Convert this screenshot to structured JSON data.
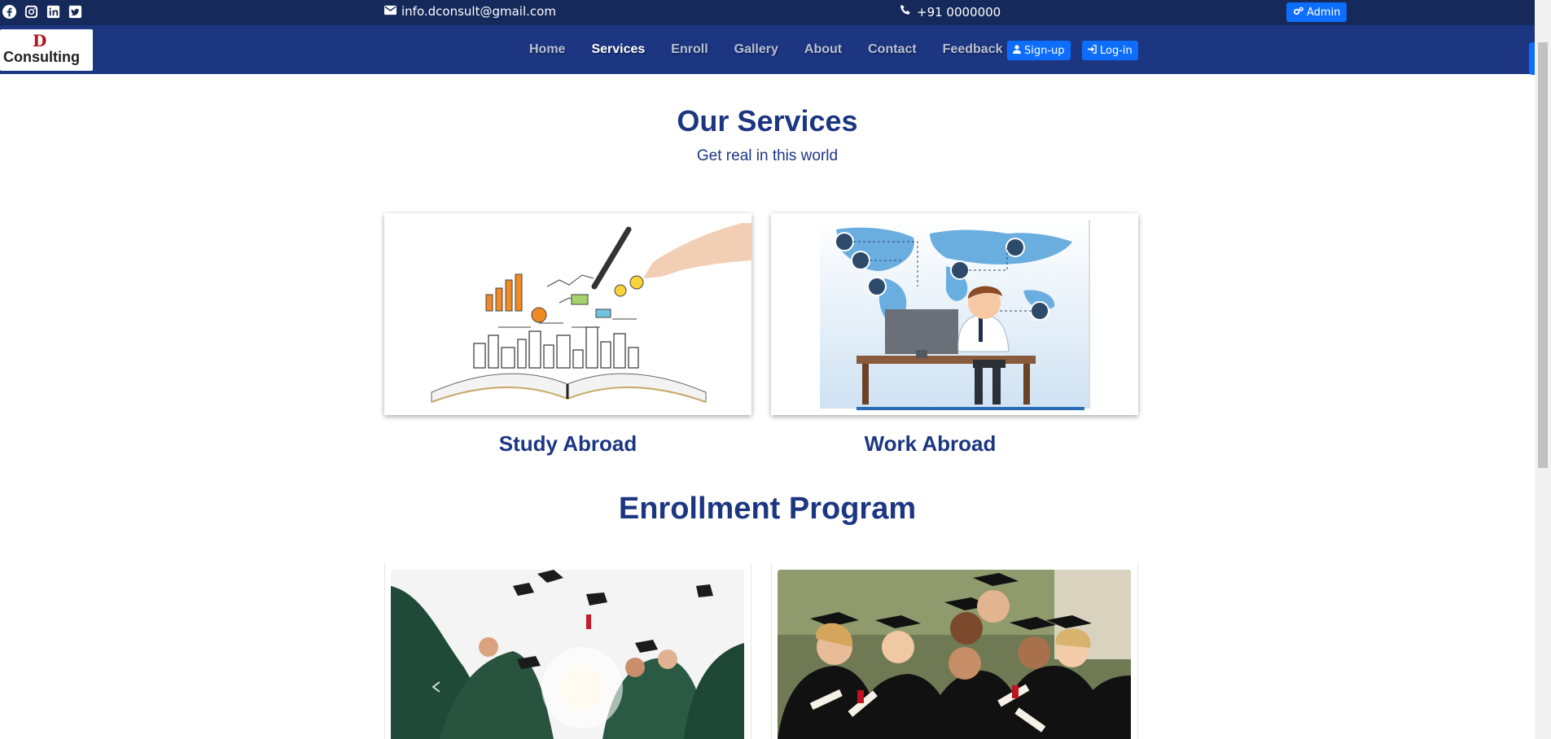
{
  "topbar": {
    "social_icons": [
      "facebook-icon",
      "instagram-icon",
      "linkedin-icon",
      "twitter-icon"
    ],
    "email": "info.dconsult@gmail.com",
    "phone": "+91 0000000",
    "admin_label": "Admin"
  },
  "brand": {
    "mark": "D",
    "name": "Consulting"
  },
  "nav": {
    "items": [
      {
        "label": "Home",
        "active": false
      },
      {
        "label": "Services",
        "active": true
      },
      {
        "label": "Enroll",
        "active": false
      },
      {
        "label": "Gallery",
        "active": false
      },
      {
        "label": "About",
        "active": false
      },
      {
        "label": "Contact",
        "active": false
      },
      {
        "label": "Feedback",
        "active": false
      }
    ],
    "signup_label": "Sign-up",
    "login_label": "Log-in"
  },
  "services": {
    "title": "Our Services",
    "subtitle": "Get real in this world",
    "cards": [
      {
        "caption": "Study Abroad"
      },
      {
        "caption": "Work Abroad"
      }
    ]
  },
  "enrollment": {
    "title": "Enrollment Program"
  },
  "colors": {
    "topbar": "#15295a",
    "navbar": "#1c3682",
    "heading": "#1c3682",
    "button": "#0d6efd"
  }
}
